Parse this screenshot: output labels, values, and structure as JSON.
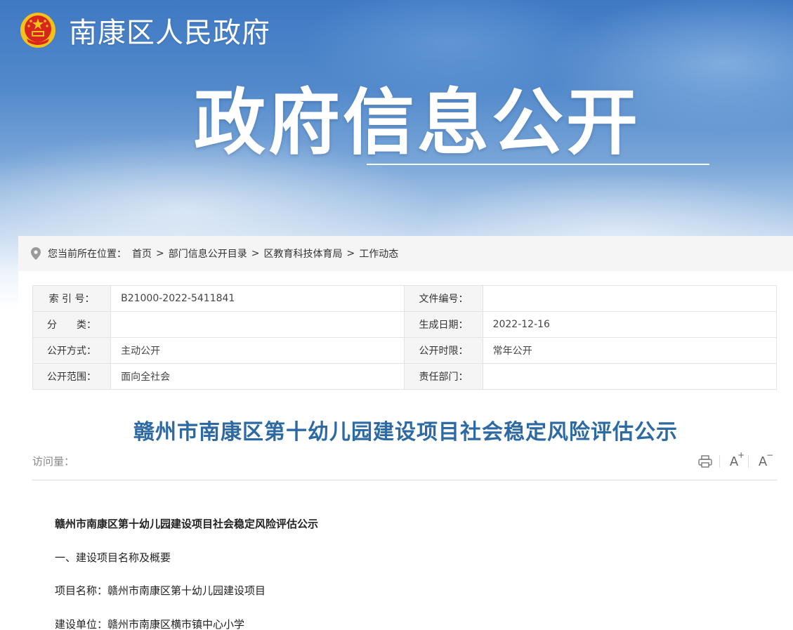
{
  "header": {
    "site_name": "南康区人民政府",
    "hero_title": "政府信息公开"
  },
  "breadcrumb": {
    "prefix": "您当前所在位置：",
    "items": [
      "首页",
      "部门信息公开目录",
      "区教育科技体育局",
      "工作动态"
    ],
    "separator": ">"
  },
  "info": {
    "rows": [
      {
        "label1": "索 引 号：",
        "value1": "B21000-2022-5411841",
        "label2": "文件编号：",
        "value2": ""
      },
      {
        "label1": "分　　类：",
        "value1": "",
        "label2": "生成日期：",
        "value2": "2022-12-16"
      },
      {
        "label1": "公开方式：",
        "value1": "主动公开",
        "label2": "公开时限：",
        "value2": "常年公开"
      },
      {
        "label1": "公开范围：",
        "value1": "面向全社会",
        "label2": "责任部门：",
        "value2": ""
      }
    ]
  },
  "article": {
    "title": "赣州市南康区第十幼儿园建设项目社会稳定风险评估公示",
    "visits_label": "访问量：",
    "font_increase": "A",
    "font_decrease": "A",
    "paragraphs": [
      "赣州市南康区第十幼儿园建设项目社会稳定风险评估公示",
      "一、建设项目名称及概要",
      "项目名称：赣州市南康区第十幼儿园建设项目",
      "建设单位：赣州市南康区横市镇中心小学"
    ]
  },
  "colors": {
    "title_blue": "#2d6aa3",
    "banner_blue": "#4a82c8",
    "emblem_red": "#d8261e",
    "emblem_gold": "#f4c21a"
  }
}
